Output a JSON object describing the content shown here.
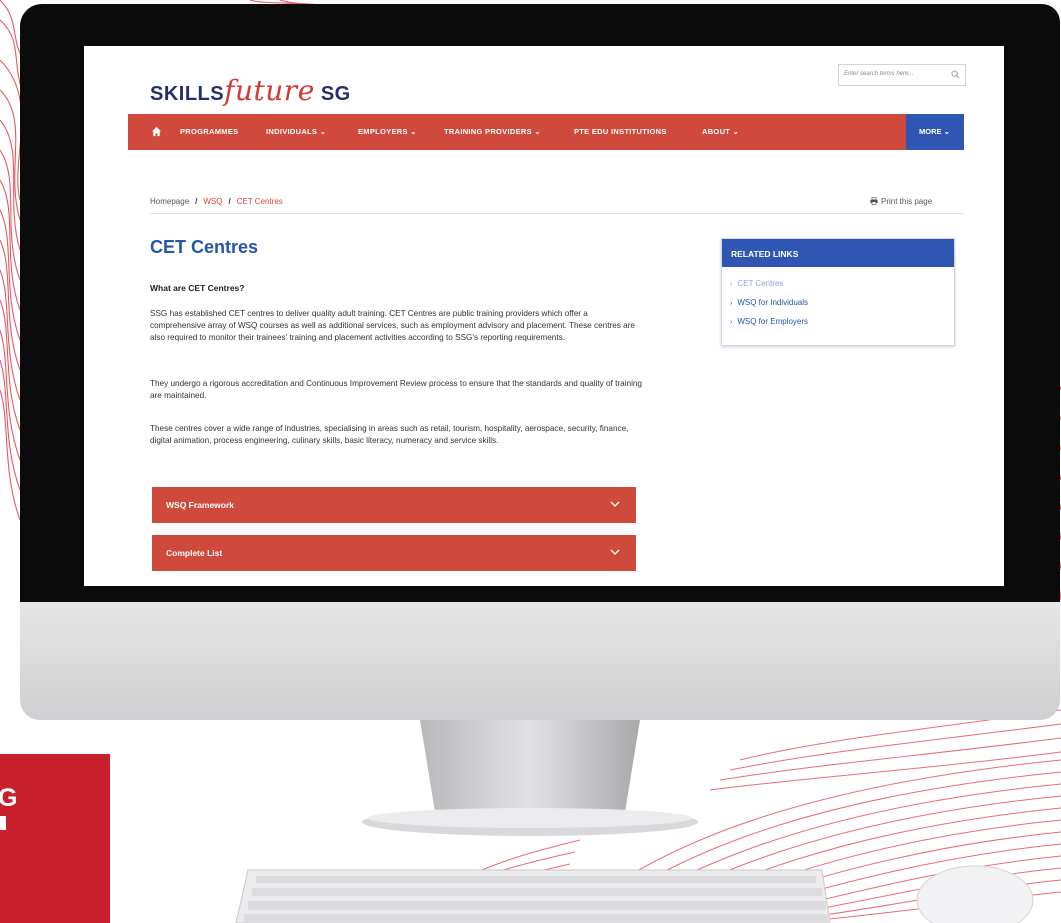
{
  "site": {
    "logo_skills": "SKILLS",
    "logo_future": "future",
    "logo_sg": "SG",
    "search_placeholder": "Enter search terms here..."
  },
  "nav": {
    "items": [
      "PROGRAMMES",
      "INDIVIDUALS ⌄",
      "EMPLOYERS ⌄",
      "TRAINING PROVIDERS ⌄",
      "PTE EDU INSTITUTIONS",
      "ABOUT ⌄"
    ],
    "more": "MORE ⌄"
  },
  "breadcrumb": {
    "home": "Homepage",
    "level1": "WSQ",
    "current": "CET Centres",
    "separator": "/"
  },
  "print_label": "Print this page",
  "content": {
    "title": "CET Centres",
    "subtitle": "What are CET Centres?",
    "p1": "SSG has established CET centres to deliver quality adult training. CET Centres are public training providers which offer a comprehensive array of WSQ courses as well as additional services, such as employment advisory and placement. These centres are also required to monitor their trainees' training and placement activities according to SSG's reporting requirements.",
    "p2": "They undergo a rigorous accreditation and Continuous Improvement Review process to ensure that the standards and quality of training are maintained.",
    "p3": "These centres cover a wide range of industries, specialising in areas such as retail, tourism, hospitality, aerospace, security, finance, digital animation, process engineering, culinary skills, basic literacy, numeracy and service skills."
  },
  "accordions": [
    "WSQ Framework",
    "Complete List"
  ],
  "related": {
    "heading": "RELATED LINKS",
    "links": [
      "CET Centres",
      "WSQ for Individuals",
      "WSQ for Employers"
    ]
  },
  "corner_tag": "G",
  "colors": {
    "brand_red": "#d0493d",
    "brand_blue": "#2f56b2",
    "title_blue": "#2556a8",
    "navy": "#25306b"
  }
}
